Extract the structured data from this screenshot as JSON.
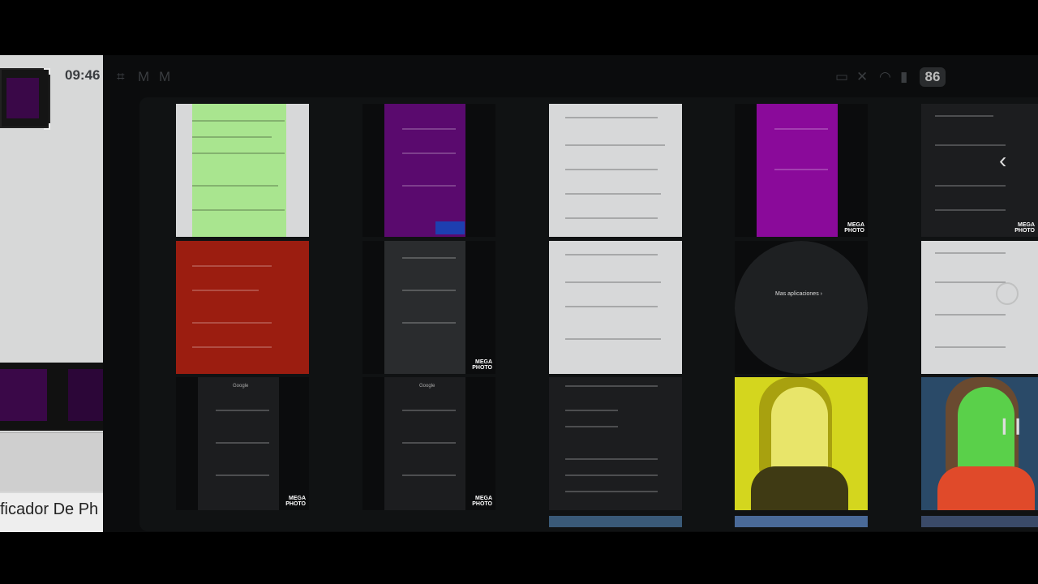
{
  "status_bar": {
    "time": "09:46",
    "left_icons": [
      "screenshot-icon",
      "gmail-icon",
      "gmail-icon"
    ],
    "right_icons": [
      "cast-icon",
      "mute-icon",
      "wifi-icon",
      "signal-icon"
    ],
    "battery": "86"
  },
  "left_panel": {
    "caption": "ficador De Ph"
  },
  "grid": {
    "tile_labels": {
      "mega_photo_line1": "MEGA",
      "mega_photo_line2": "PHOTO",
      "table_title": "Google",
      "overlay": "Mas aplicaciones  ›"
    }
  },
  "colors": {
    "green_tint": "#a9e58f",
    "purple_tint": "#5a0a6e",
    "red_tint": "#9b1d10",
    "yellow_tint": "#d4d61e",
    "light_gray": "#d7d8d9",
    "dark_gray": "#1c1d1f"
  }
}
